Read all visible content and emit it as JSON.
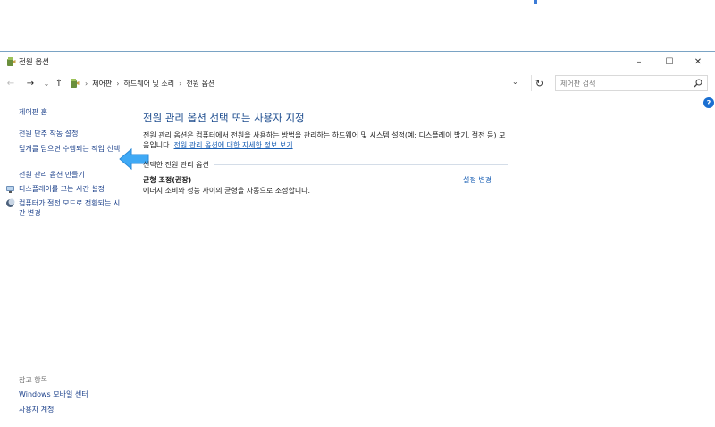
{
  "window": {
    "title": "전원 옵션",
    "controls": {
      "minimize": "–",
      "maximize": "☐",
      "close": "✕"
    }
  },
  "nav": {
    "back": "←",
    "forward": "→",
    "recent": "⌄",
    "up": "↑",
    "breadcrumb": [
      "제어판",
      "하드웨어 및 소리",
      "전원 옵션"
    ],
    "separator": "›",
    "dropdown": "⌄",
    "refresh": "↻",
    "search_placeholder": "제어판 검색"
  },
  "help": "?",
  "sidebar": {
    "home": "제어판 홈",
    "links": [
      "전원 단추 작동 설정",
      "덮개를 닫으면 수행되는 작업 선택",
      "전원 관리 옵션 만들기",
      "디스플레이를 끄는 시간 설정",
      "컴퓨터가 절전 모드로 전환되는 시간 변경"
    ],
    "see_also": "참고 항목",
    "see_also_links": [
      "Windows 모바일 센터",
      "사용자 계정"
    ]
  },
  "main": {
    "title": "전원 관리 옵션 선택 또는 사용자 지정",
    "description": "전원 관리 옵션은 컴퓨터에서 전원을 사용하는 방법을 관리하는 하드웨어 및 시스템 설정(예: 디스플레이 밝기, 절전 등) 모음입니다. ",
    "description_link": "전원 관리 옵션에 대한 자세한 정보 보기",
    "section_label": "선택한 전원 관리 옵션",
    "plan_name": "균형 조정(권장)",
    "plan_change": "설정 변경",
    "plan_description": "에너지 소비와 성능 사이의 균형을 자동으로 조정합니다."
  },
  "colors": {
    "accent": "#1a5fb4",
    "title_blue": "#1e4d8f",
    "arrow_blue": "#3fa9f5"
  }
}
